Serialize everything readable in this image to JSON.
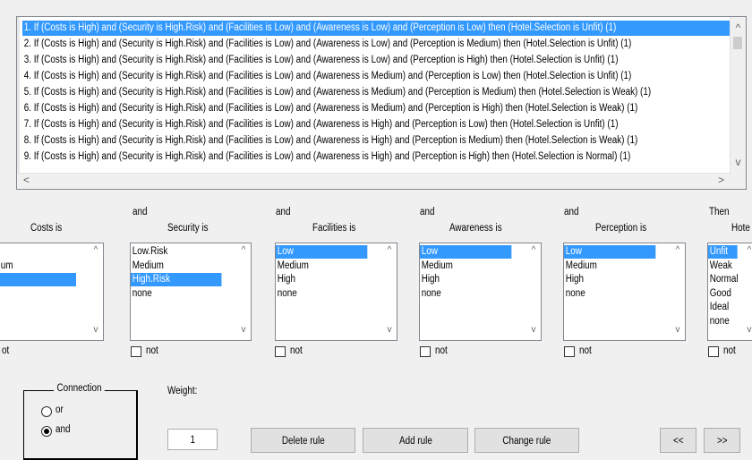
{
  "rules": [
    "1. If (Costs is High) and (Security is High.Risk) and (Facilities is Low) and (Awareness is Low) and (Perception is Low) then (Hotel.Selection is Unfit) (1)",
    "2. If (Costs is High) and (Security is High.Risk) and (Facilities is Low) and (Awareness is Low) and (Perception is Medium) then (Hotel.Selection is Unfit) (1)",
    "3. If (Costs is High) and (Security is High.Risk) and (Facilities is Low) and (Awareness is Low) and (Perception is High) then (Hotel.Selection is Unfit) (1)",
    "4. If (Costs is High) and (Security is High.Risk) and (Facilities is Low) and (Awareness is Medium) and (Perception is Low) then (Hotel.Selection is Unfit) (1)",
    "5. If (Costs is High) and (Security is High.Risk) and (Facilities is Low) and (Awareness is Medium) and (Perception is Medium) then (Hotel.Selection is Weak) (1)",
    "6. If (Costs is High) and (Security is High.Risk) and (Facilities is Low) and (Awareness is Medium) and (Perception is High) then (Hotel.Selection is Weak) (1)",
    "7. If (Costs is High) and (Security is High.Risk) and (Facilities is Low) and (Awareness is High) and (Perception is Low) then (Hotel.Selection is Unfit) (1)",
    "8. If (Costs is High) and (Security is High.Risk) and (Facilities is Low) and (Awareness is High) and (Perception is Medium) then (Hotel.Selection is Weak) (1)",
    "9. If (Costs is High) and (Security is High.Risk) and (Facilities is Low) and (Awareness is High) and (Perception is High) then (Hotel.Selection is Normal) (1)"
  ],
  "selected_rule_index": 0,
  "scroll": {
    "up": "^",
    "down": "v",
    "left": "<",
    "right": ">"
  },
  "connectors": {
    "and": "and",
    "then": "Then"
  },
  "variables": [
    {
      "label": "Costs is",
      "options": [
        "",
        "um",
        "",
        ""
      ],
      "selected": 2,
      "not_label": "ot"
    },
    {
      "label": "Security is",
      "options": [
        "Low.Risk",
        "Medium",
        "High.Risk",
        "none"
      ],
      "selected": 2,
      "not_label": "not"
    },
    {
      "label": "Facilities is",
      "options": [
        "Low",
        "Medium",
        "High",
        "none"
      ],
      "selected": 0,
      "not_label": "not"
    },
    {
      "label": "Awareness is",
      "options": [
        "Low",
        "Medium",
        "High",
        "none"
      ],
      "selected": 0,
      "not_label": "not"
    },
    {
      "label": "Perception is",
      "options": [
        "Low",
        "Medium",
        "High",
        "none"
      ],
      "selected": 0,
      "not_label": "not"
    },
    {
      "label": "Hote",
      "options": [
        "Unfit",
        "Weak",
        "Normal",
        "Good",
        "Ideal",
        "none"
      ],
      "selected": 0,
      "not_label": "not"
    }
  ],
  "connection": {
    "title": "Connection",
    "options": [
      "or",
      "and"
    ],
    "selected": "and"
  },
  "weight": {
    "label": "Weight:",
    "value": "1"
  },
  "buttons": {
    "delete": "Delete rule",
    "add": "Add rule",
    "change": "Change rule",
    "prev": "<<",
    "next": ">>"
  },
  "colors": {
    "selection": "#3399ff",
    "background": "#f0f0f0"
  }
}
